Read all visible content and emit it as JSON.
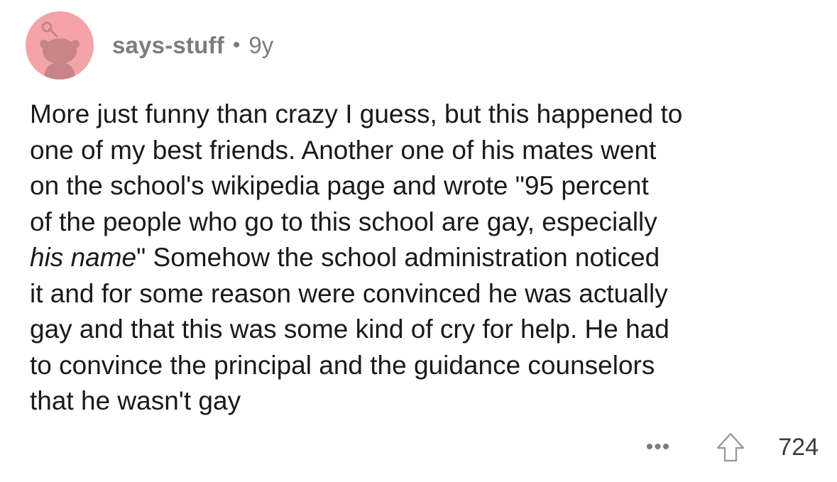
{
  "comment": {
    "author": "says-stuff",
    "separator": "•",
    "age": "9y",
    "body_lines": [
      "More just funny than crazy I guess, but this happened to",
      "one of my best friends. Another one of his mates went",
      "on the school's wikipedia page and wrote \"95 percent",
      "of the people who go to this school are gay, especially",
      {
        "italic": "his name",
        "rest": "\"  Somehow the school administration noticed"
      },
      "it and for some reason were convinced he was actually",
      "gay and that this was some kind of cry for help. He had",
      "to convince the principal and the guidance counselors",
      "that he wasn't gay"
    ],
    "more_label": "•••",
    "upvote_icon": "upvote-arrow-icon",
    "score": "724"
  },
  "colors": {
    "avatar_bg": "#f4a3a8",
    "avatar_snoo": "#c98489",
    "meta_text": "#7c7c7c",
    "body_text": "#1a1a1b"
  }
}
